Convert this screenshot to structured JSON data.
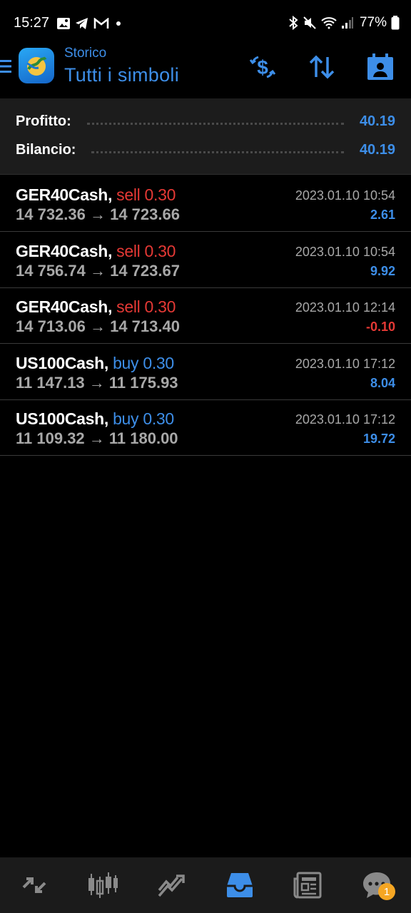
{
  "status_bar": {
    "time": "15:27",
    "battery": "77%"
  },
  "header": {
    "subtitle": "Storico",
    "title": "Tutti i simboli"
  },
  "summary": {
    "profit_label": "Profitto:",
    "profit_value": "40.19",
    "balance_label": "Bilancio:",
    "balance_value": "40.19"
  },
  "trades": [
    {
      "symbol": "GER40Cash,",
      "side": "sell 0.30",
      "prices": "14 732.36 → 14 723.66",
      "datetime": "2023.01.10 10:54",
      "profit": "2.61"
    },
    {
      "symbol": "GER40Cash,",
      "side": "sell 0.30",
      "prices": "14 756.74 → 14 723.67",
      "datetime": "2023.01.10 10:54",
      "profit": "9.92"
    },
    {
      "symbol": "GER40Cash,",
      "side": "sell 0.30",
      "prices": "14 713.06 → 14 713.40",
      "datetime": "2023.01.10 12:14",
      "profit": "-0.10"
    },
    {
      "symbol": "US100Cash,",
      "side": "buy 0.30",
      "prices": "11 147.13 → 11 175.93",
      "datetime": "2023.01.10 17:12",
      "profit": "8.04"
    },
    {
      "symbol": "US100Cash,",
      "side": "buy 0.30",
      "prices": "11 109.32 → 11 180.00",
      "datetime": "2023.01.10 17:12",
      "profit": "19.72"
    }
  ],
  "bottom_nav": {
    "items": [
      "quotes-icon",
      "chart-icon",
      "trade-icon",
      "history-icon",
      "news-icon",
      "chat-icon"
    ],
    "active": "history-icon",
    "chat_badge": "1"
  },
  "colors": {
    "accent": "#3d8ee8",
    "sell": "#e53935",
    "buy": "#3d8ee8",
    "badge": "#f5a623"
  }
}
